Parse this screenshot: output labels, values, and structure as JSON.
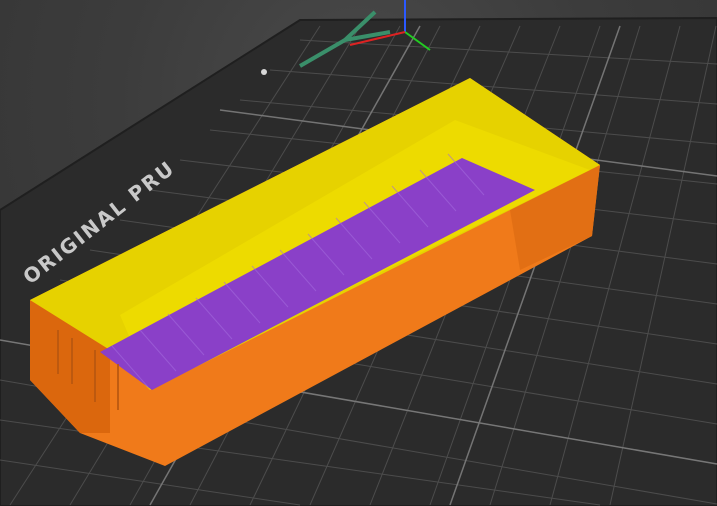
{
  "scene": {
    "bed_logo_text": "ORIGINAL PRU",
    "colors": {
      "background": "#3b3b3b",
      "bed_surface": "#2b2b2b",
      "bed_grid_minor": "#4a4a4a",
      "bed_grid_major": "#8a8a8a",
      "model_outer_wall": "#f07a1a",
      "model_inner_wall": "#e6d200",
      "model_infill": "#8a40c8",
      "axis_x": "#d22",
      "axis_y": "#2c2",
      "axis_z": "#22a",
      "axis_arrow": "#3a8f6a"
    },
    "icons": [
      "coordinate-axes-icon"
    ]
  }
}
